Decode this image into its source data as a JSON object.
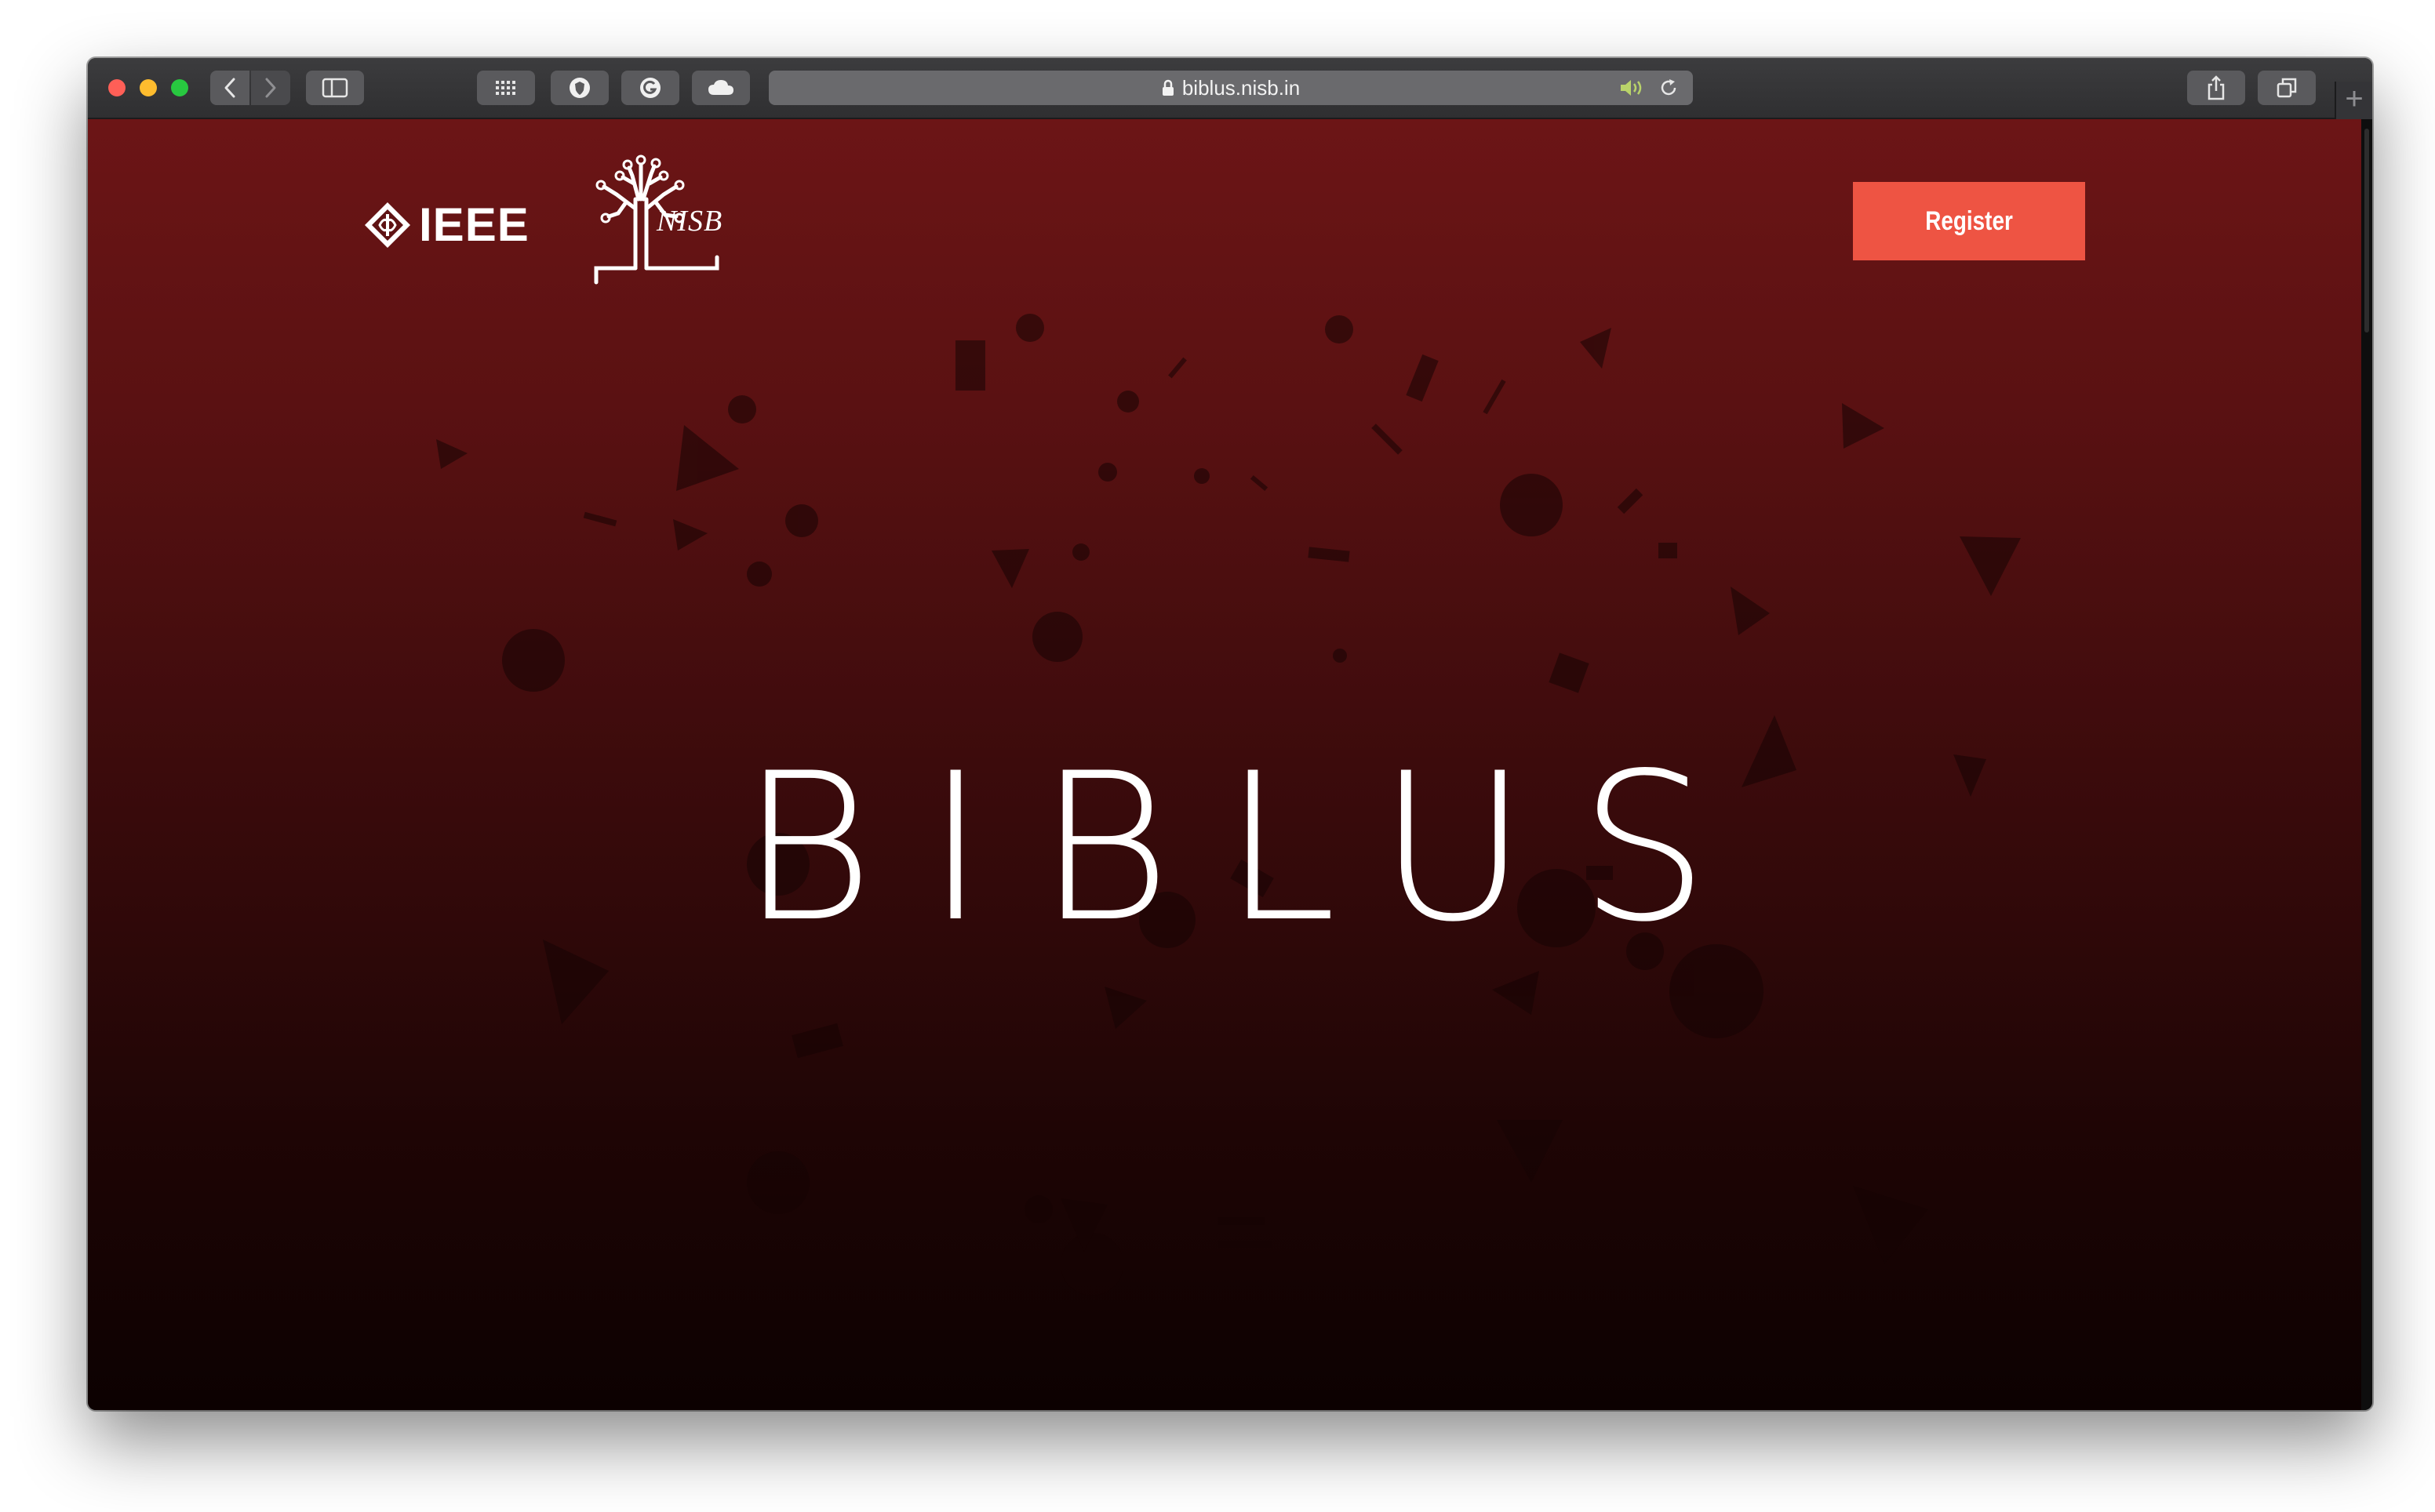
{
  "browser": {
    "url": "biblus.nisb.in",
    "new_tab_symbol": "+"
  },
  "header": {
    "ieee_logo_text": "IEEE",
    "nisb_logo_text": "NISB",
    "register_label": "Register"
  },
  "hero": {
    "title": "BIBLUS"
  },
  "colors": {
    "register_button": "#ee5443",
    "background_top": "#6c1516",
    "background_bottom": "#0c0101"
  }
}
